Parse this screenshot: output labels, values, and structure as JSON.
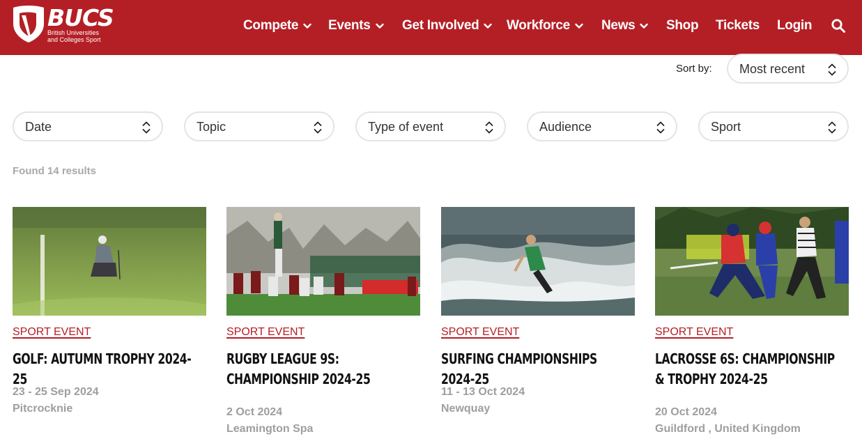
{
  "brand": {
    "name": "BUCS",
    "tagline_line1": "British Universities",
    "tagline_line2": "and Colleges Sport",
    "color": "#b41f25"
  },
  "nav": {
    "items": [
      {
        "label": "Compete",
        "has_dropdown": true
      },
      {
        "label": "Events",
        "has_dropdown": true
      },
      {
        "label": "Get Involved",
        "has_dropdown": true
      },
      {
        "label": "Workforce",
        "has_dropdown": true
      },
      {
        "label": "News",
        "has_dropdown": true
      },
      {
        "label": "Shop",
        "has_dropdown": false
      },
      {
        "label": "Tickets",
        "has_dropdown": false
      },
      {
        "label": "Login",
        "has_dropdown": false
      }
    ],
    "search_icon": "search-icon"
  },
  "sort": {
    "label": "Sort by:",
    "value": "Most recent"
  },
  "filters": [
    {
      "value": "Date"
    },
    {
      "value": "Topic"
    },
    {
      "value": "Type of event"
    },
    {
      "value": "Audience"
    },
    {
      "value": "Sport"
    }
  ],
  "results": {
    "found_text": "Found 14 results"
  },
  "events": [
    {
      "tag": "SPORT EVENT",
      "title": "GOLF: AUTUMN TROPHY 2024-25",
      "date": "23 - 25 Sep 2024",
      "location": "Pitcrocknie"
    },
    {
      "tag": "SPORT EVENT",
      "title": "RUGBY LEAGUE 9S: CHAMPIONSHIP 2024-25",
      "date": "2 Oct 2024",
      "location": "Leamington Spa"
    },
    {
      "tag": "SPORT EVENT",
      "title": "SURFING CHAMPIONSHIPS 2024-25",
      "date": "11 - 13 Oct 2024",
      "location": "Newquay"
    },
    {
      "tag": "SPORT EVENT",
      "title": "LACROSSE 6S: CHAMPIONSHIP & TROPHY 2024-25",
      "date": "20 Oct 2024",
      "location": "Guildford , United Kingdom"
    }
  ]
}
